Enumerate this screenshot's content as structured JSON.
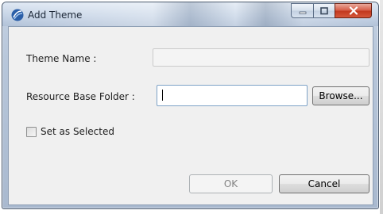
{
  "window": {
    "title": "Add Theme",
    "app_icon": "eclipse-app-icon",
    "controls": {
      "minimize_icon": "minimize-icon",
      "maximize_icon": "maximize-icon",
      "close_icon": "close-icon"
    }
  },
  "form": {
    "theme_name": {
      "label": "Theme Name :",
      "value": "",
      "enabled": false
    },
    "resource_base_folder": {
      "label": "Resource Base Folder :",
      "value": "",
      "focused": true
    },
    "browse_label": "Browse...",
    "set_as_selected": {
      "label": "Set as Selected",
      "checked": false
    }
  },
  "buttons": {
    "ok": {
      "label": "OK",
      "enabled": false
    },
    "cancel": {
      "label": "Cancel",
      "enabled": true
    }
  },
  "colors": {
    "close_button": "#c2391f",
    "dialog_background": "#f0f0f0",
    "frame": "#b7c6da"
  }
}
